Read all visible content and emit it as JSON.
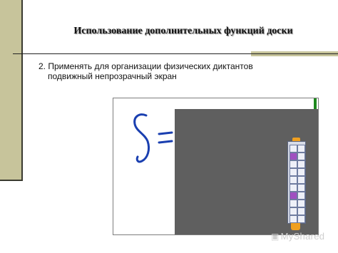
{
  "slide": {
    "title": "Использование дополнительных функций доски",
    "body_line1": "2. Применять для организации физических диктантов",
    "body_line2": "подвижный непрозрачный экран"
  },
  "board": {
    "handwriting": "S=",
    "ink_color": "#1a3fb0",
    "curtain_color": "#5f5f5f",
    "toolbar_icons": [
      "pointer-icon",
      "pen-icon",
      "marker-icon",
      "highlighter-icon",
      "line-icon",
      "shape-icon",
      "eraser-icon",
      "text-icon",
      "curtain-icon",
      "spotlight-icon",
      "capture-icon",
      "undo-icon",
      "redo-icon",
      "delete-icon",
      "keyboard-icon",
      "menu-icon",
      "page-icon",
      "color-icon",
      "zoom-icon",
      "hide-icon"
    ]
  },
  "watermark": {
    "text": "MyShared"
  }
}
